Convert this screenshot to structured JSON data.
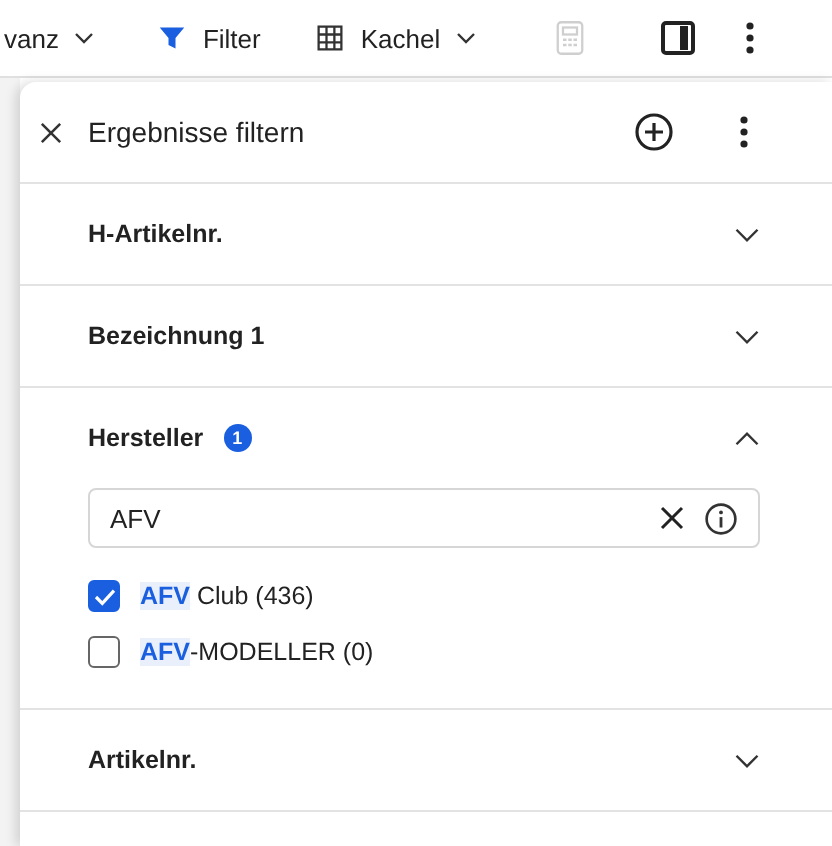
{
  "toolbar": {
    "sort_label": "vanz",
    "filter_label": "Filter",
    "view_label": "Kachel",
    "calculator": {
      "disabled": true
    }
  },
  "panel": {
    "title": "Ergebnisse filtern",
    "sections": [
      {
        "title": "H-Artikelnr.",
        "expanded": false
      },
      {
        "title": "Bezeichnung 1",
        "expanded": false
      },
      {
        "title": "Hersteller",
        "expanded": true,
        "badge": "1",
        "search": {
          "value": "AFV"
        },
        "options": [
          {
            "match": "AFV",
            "rest": " Club (436)",
            "checked": true
          },
          {
            "match": "AFV",
            "rest": "-MODELLER (0)",
            "checked": false
          }
        ]
      },
      {
        "title": "Artikelnr.",
        "expanded": false
      }
    ]
  }
}
